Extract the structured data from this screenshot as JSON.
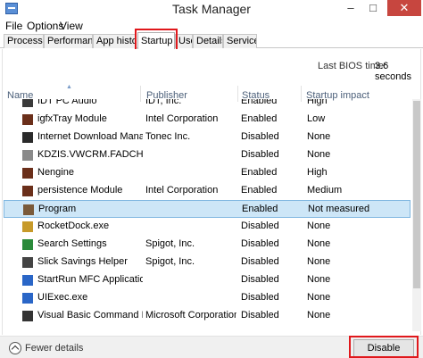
{
  "window": {
    "title": "Task Manager",
    "controls": {
      "minimize": "–",
      "maximize": "□",
      "close": "✕"
    }
  },
  "menu": [
    "File",
    "Options",
    "View"
  ],
  "tabs": [
    {
      "label": "Processes",
      "active": false
    },
    {
      "label": "Performance",
      "active": false
    },
    {
      "label": "App histor",
      "active": false
    },
    {
      "label": "Startup",
      "active": true
    },
    {
      "label": "Users",
      "active": false
    },
    {
      "label": "Details",
      "active": false
    },
    {
      "label": "Services",
      "active": false
    }
  ],
  "bios": {
    "label": "Last BIOS time:",
    "value": "3.6 seconds"
  },
  "columns": {
    "name": "Name",
    "publisher": "Publisher",
    "status": "Status",
    "impact": "Startup impact"
  },
  "rows": [
    {
      "name": "IDT PC Audio",
      "publisher": "IDT, Inc.",
      "status": "Enabled",
      "impact": "High",
      "icon": "audio-icon",
      "color": "#3a3a3a"
    },
    {
      "name": "igfxTray Module",
      "publisher": "Intel Corporation",
      "status": "Enabled",
      "impact": "Low",
      "icon": "module-icon",
      "color": "#6b2f1a"
    },
    {
      "name": "Internet Download Manager...",
      "publisher": "Tonec Inc.",
      "status": "Disabled",
      "impact": "None",
      "icon": "download-icon",
      "color": "#2a2a2a"
    },
    {
      "name": "KDZIS.VWCRM.FADCH.vbe",
      "publisher": "",
      "status": "Disabled",
      "impact": "None",
      "icon": "script-icon",
      "color": "#8a8a8a"
    },
    {
      "name": "Nengine",
      "publisher": "",
      "status": "Enabled",
      "impact": "High",
      "icon": "program-icon",
      "color": "#6b2f1a"
    },
    {
      "name": "persistence Module",
      "publisher": "Intel Corporation",
      "status": "Enabled",
      "impact": "Medium",
      "icon": "module-icon",
      "color": "#6b2f1a"
    },
    {
      "name": "Program",
      "publisher": "",
      "status": "Enabled",
      "impact": "Not measured",
      "icon": "program-icon",
      "color": "#7a5a3a",
      "selected": true
    },
    {
      "name": "RocketDock.exe",
      "publisher": "",
      "status": "Disabled",
      "impact": "None",
      "icon": "rocketdock-icon",
      "color": "#c79a2a"
    },
    {
      "name": "Search Settings",
      "publisher": "Spigot, Inc.",
      "status": "Disabled",
      "impact": "None",
      "icon": "search-icon",
      "color": "#2a8a3a"
    },
    {
      "name": "Slick Savings Helper",
      "publisher": "Spigot, Inc.",
      "status": "Disabled",
      "impact": "None",
      "icon": "helper-icon",
      "color": "#444444"
    },
    {
      "name": "StartRun MFC Application",
      "publisher": "",
      "status": "Disabled",
      "impact": "None",
      "icon": "app-icon",
      "color": "#2a66c7"
    },
    {
      "name": "UIExec.exe",
      "publisher": "",
      "status": "Disabled",
      "impact": "None",
      "icon": "window-icon",
      "color": "#2a66c7"
    },
    {
      "name": "Visual Basic Command Line ...",
      "publisher": "Microsoft Corporation",
      "status": "Disabled",
      "impact": "None",
      "icon": "vb-icon",
      "color": "#333333"
    }
  ],
  "footer": {
    "fewer_details": "Fewer details",
    "disable": "Disable"
  }
}
